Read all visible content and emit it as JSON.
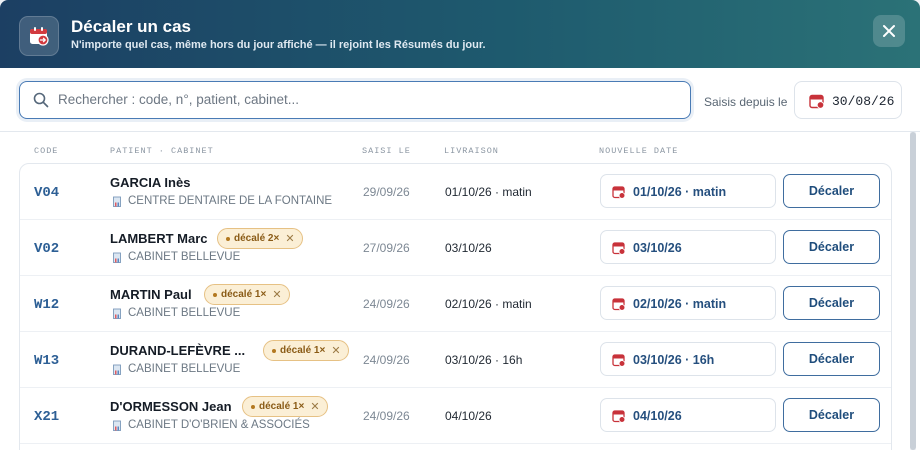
{
  "header": {
    "icon": "calendar-move-icon",
    "title": "Décaler un cas",
    "subtitle": "N'importe quel cas, même hors du jour affiché — il rejoint les Résumés du jour.",
    "close_icon": "close-icon"
  },
  "search": {
    "placeholder": "Rechercher : code, n°, patient, cabinet...",
    "value": ""
  },
  "since": {
    "label": "Saisis depuis le",
    "date": "30/08/26"
  },
  "columns": {
    "code": "CODE",
    "patient": "PATIENT · CABINET",
    "saisi": "SAISI LE",
    "livraison": "LIVRAISON",
    "nouvelle": "NOUVELLE DATE"
  },
  "rows": [
    {
      "code": "V04",
      "patient": "GARCIA Inès",
      "badge": "",
      "cabinet": "CENTRE DENTAIRE DE LA FONTAINE",
      "saisi": "29/09/26",
      "livraison": "01/10/26 · matin",
      "new_date": "01/10/26 · matin",
      "action": "Décaler"
    },
    {
      "code": "V02",
      "patient": "LAMBERT Marc",
      "badge": "décalé 2×",
      "cabinet": "CABINET BELLEVUE",
      "saisi": "27/09/26",
      "livraison": "03/10/26",
      "new_date": "03/10/26",
      "action": "Décaler"
    },
    {
      "code": "W12",
      "patient": "MARTIN Paul",
      "badge": "décalé 1×",
      "cabinet": "CABINET BELLEVUE",
      "saisi": "24/09/26",
      "livraison": "02/10/26 · matin",
      "new_date": "02/10/26 · matin",
      "action": "Décaler"
    },
    {
      "code": "W13",
      "patient": "DURAND-LEFÈVRE ...",
      "badge": "décalé 1×",
      "cabinet": "CABINET BELLEVUE",
      "saisi": "24/09/26",
      "livraison": "03/10/26 · 16h",
      "new_date": "03/10/26 · 16h",
      "action": "Décaler"
    },
    {
      "code": "X21",
      "patient": "D'ORMESSON Jean",
      "badge": "décalé 1×",
      "cabinet": "CABINET D'O'BRIEN & ASSOCIÉS",
      "saisi": "24/09/26",
      "livraison": "04/10/26",
      "new_date": "04/10/26",
      "action": "Décaler"
    }
  ],
  "colors": {
    "header_start": "#1c3f63",
    "header_end": "#2b7277",
    "accent": "#2d5f95",
    "badge_bg": "#fbefd6",
    "calendar_red": "#c8323a"
  }
}
